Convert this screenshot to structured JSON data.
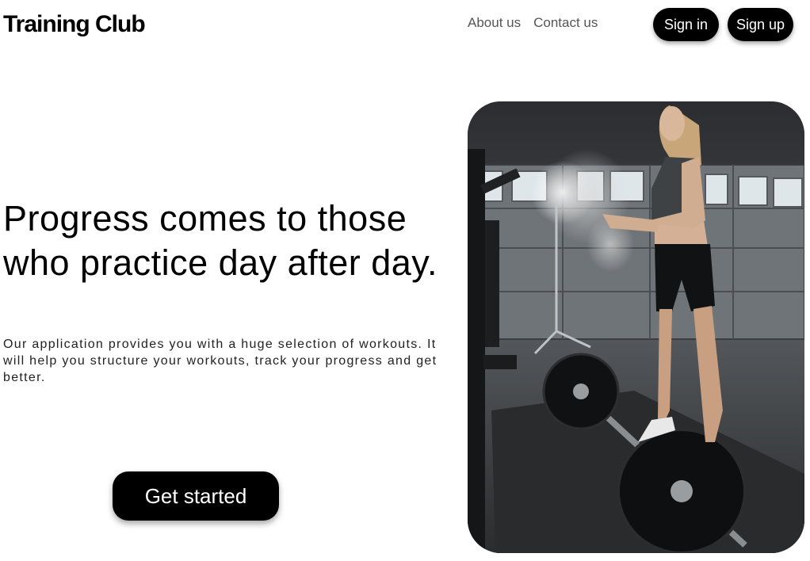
{
  "header": {
    "brand": "Training Club",
    "nav": [
      "About us",
      "Contact us"
    ],
    "sign_in": "Sign in",
    "sign_up": "Sign up"
  },
  "hero": {
    "headline": "Progress comes to those who practice day after day.",
    "description": "Our application provides you with a huge selection of workouts. It will help you structure your workouts, track your progress and get better.",
    "cta": "Get started"
  }
}
